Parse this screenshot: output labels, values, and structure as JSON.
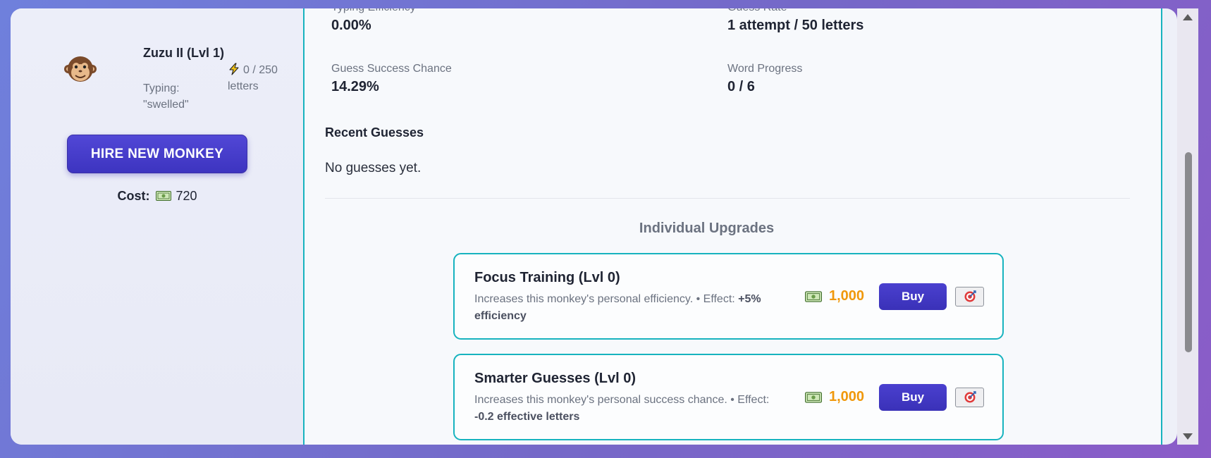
{
  "monkey": {
    "name": "Zuzu II (Lvl 1)",
    "typing": "Typing: \"swelled\"",
    "energy": "0 / 250 letters",
    "avatar_icon": "monkey-face-icon"
  },
  "hire": {
    "button_label": "HIRE NEW MONKEY",
    "cost_label": "Cost:",
    "cost_value": "720"
  },
  "stats": [
    {
      "label": "Typing Efficiency",
      "value": "0.00%"
    },
    {
      "label": "Guess Rate",
      "value": "1 attempt / 50 letters"
    },
    {
      "label": "Guess Success Chance",
      "value": "14.29%"
    },
    {
      "label": "Word Progress",
      "value": "0 / 6"
    }
  ],
  "recent": {
    "title": "Recent Guesses",
    "empty_text": "No guesses yet."
  },
  "upgrades": {
    "title": "Individual Upgrades",
    "items": [
      {
        "name": "Focus Training (Lvl 0)",
        "desc": "Increases this monkey's personal efficiency. • Effect:",
        "effect": "+5% efficiency",
        "cost": "1,000",
        "buy_label": "Buy"
      },
      {
        "name": "Smarter Guesses (Lvl 0)",
        "desc": "Increases this monkey's personal success chance. • Effect:",
        "effect": "-0.2 effective letters",
        "cost": "1,000",
        "buy_label": "Buy"
      }
    ]
  },
  "colors": {
    "accent": "#4a40cf",
    "border_teal": "#17b3bf",
    "cost_orange": "#f0980b"
  }
}
